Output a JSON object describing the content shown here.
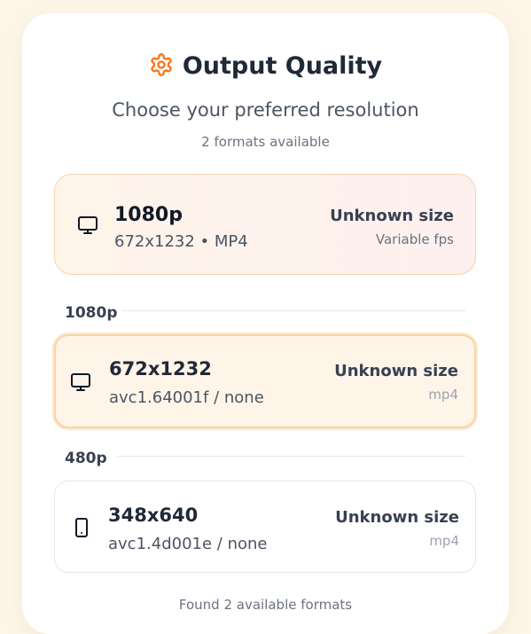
{
  "header": {
    "title": "Output Quality",
    "icon": "gear-icon",
    "accent_color": "#f97316"
  },
  "subtitle": "Choose your preferred resolution",
  "format_count": "2 formats available",
  "selected": {
    "icon": "monitor-icon",
    "resolution": "1080p",
    "detail": "672x1232 • MP4",
    "size": "Unknown size",
    "fps": "Variable fps"
  },
  "groups": [
    {
      "label": "1080p",
      "option": {
        "icon": "monitor-icon",
        "resolution": "672x1232",
        "codec": "avc1.64001f / none",
        "size": "Unknown size",
        "ext": "mp4",
        "active": true
      }
    },
    {
      "label": "480p",
      "option": {
        "icon": "phone-icon",
        "resolution": "348x640",
        "codec": "avc1.4d001e / none",
        "size": "Unknown size",
        "ext": "mp4",
        "active": false
      }
    }
  ],
  "footer": "Found 2 available formats"
}
